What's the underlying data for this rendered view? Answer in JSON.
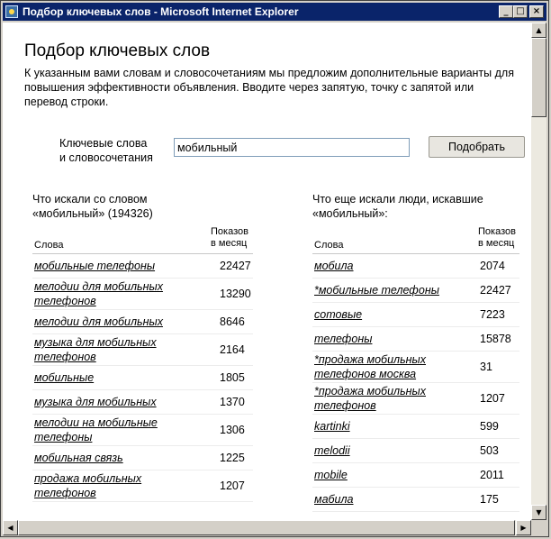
{
  "window": {
    "title": "Подбор ключевых слов - Microsoft Internet Explorer",
    "minimize": "_",
    "maximize": "□",
    "close": "×"
  },
  "page": {
    "heading": "Подбор ключевых слов",
    "intro": "К указанным вами словам и словосочетаниям мы предложим дополнительные варианты для повышения эффективности объявления. Вводите через запятую, точку с запятой или перевод строки."
  },
  "form": {
    "label_line1": "Ключевые слова",
    "label_line2": "и словосочетания",
    "value": "мобильный",
    "button": "Подобрать"
  },
  "left": {
    "heading_line1": "Что искали со словом",
    "heading_line2": "«мобильный» (194326)",
    "col_words": "Слова",
    "col_count_line1": "Показов",
    "col_count_line2": "в месяц",
    "rows": [
      {
        "phrase": "мобильные телефоны",
        "count": "22427"
      },
      {
        "phrase": "мелодии для мобильных телефонов",
        "count": "13290"
      },
      {
        "phrase": "мелодии для мобильных",
        "count": "8646"
      },
      {
        "phrase": "музыка для мобильных телефонов",
        "count": "2164"
      },
      {
        "phrase": "мобильные",
        "count": "1805"
      },
      {
        "phrase": "музыка для мобильных",
        "count": "1370"
      },
      {
        "phrase": "мелодии на мобильные телефоны",
        "count": "1306"
      },
      {
        "phrase": "мобильная связь",
        "count": "1225"
      },
      {
        "phrase": "продажа мобильных телефонов",
        "count": "1207"
      }
    ]
  },
  "right": {
    "heading_line1": "Что еще искали люди, искавшие",
    "heading_line2": "«мобильный»:",
    "col_words": "Слова",
    "col_count_line1": "Показов",
    "col_count_line2": "в месяц",
    "rows": [
      {
        "phrase": "мобила",
        "count": "2074"
      },
      {
        "phrase": "*мобильные телефоны",
        "count": "22427"
      },
      {
        "phrase": "сотовые",
        "count": "7223"
      },
      {
        "phrase": "телефоны",
        "count": "15878"
      },
      {
        "phrase": "*продажа мобильных телефонов москва",
        "count": "31"
      },
      {
        "phrase": "*продажа мобильных телефонов",
        "count": "1207"
      },
      {
        "phrase": "kartinki",
        "count": "599"
      },
      {
        "phrase": "melodii",
        "count": "503"
      },
      {
        "phrase": "mobile",
        "count": "2011"
      },
      {
        "phrase": "мабила",
        "count": "175"
      }
    ]
  },
  "icons": {
    "title_icon": "ie-page-icon",
    "scroll_up": "arrow-up-icon",
    "scroll_down": "arrow-down-icon",
    "scroll_left": "arrow-left-icon",
    "scroll_right": "arrow-right-icon"
  },
  "colors": {
    "titlebar": "#0a246a",
    "chrome": "#d4d0c8",
    "page": "#ffffff"
  }
}
